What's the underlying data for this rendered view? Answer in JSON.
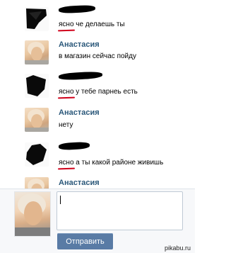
{
  "messages": [
    {
      "author": "",
      "author_hidden": true,
      "text_first": "ясно",
      "text_rest": " че делаешь ты"
    },
    {
      "author": "Анастасия",
      "author_hidden": false,
      "text_first": "в",
      "text_rest": " магазин сейчас пойду"
    },
    {
      "author": "",
      "author_hidden": true,
      "text_first": "ясно",
      "text_rest": " у тебе парнеь есть"
    },
    {
      "author": "Анастасия",
      "author_hidden": false,
      "text_first": "нету",
      "text_rest": ""
    },
    {
      "author": "",
      "author_hidden": true,
      "text_first": "ясно",
      "text_rest": " а ты какой районе живишь"
    },
    {
      "author": "Анастасия",
      "author_hidden": false,
      "text_first": "",
      "text_rest": ""
    }
  ],
  "composer": {
    "value": "",
    "placeholder": "",
    "send_label": "Отправить"
  },
  "watermark": "pikabu.ru",
  "colors": {
    "name": "#2b587a",
    "send_button": "#597ba5",
    "underline": "#d0021b",
    "scribble": "#000000"
  }
}
